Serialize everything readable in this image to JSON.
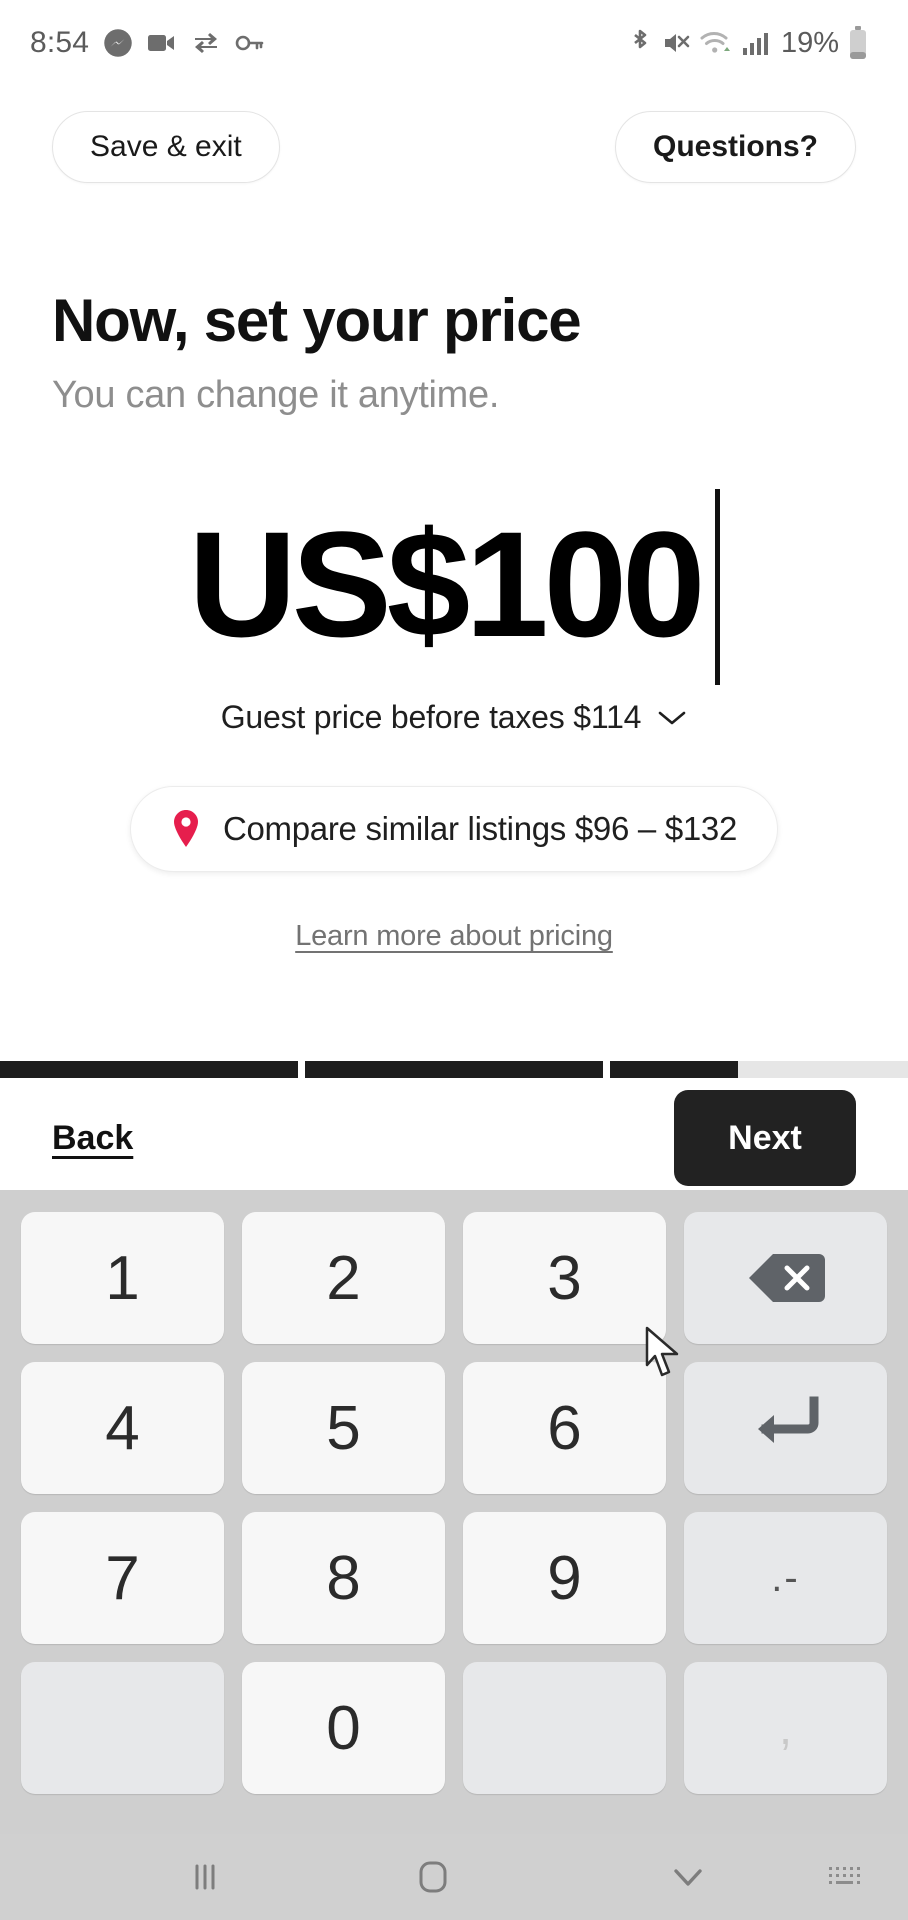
{
  "status_bar": {
    "time": "8:54",
    "battery_percent": "19%",
    "left_icons": [
      "messenger-icon",
      "video-recorder-icon",
      "vpn-icon",
      "key-icon"
    ],
    "right_icons": [
      "bluetooth-icon",
      "mute-icon",
      "wifi-icon",
      "cellular-signal-icon",
      "battery-icon"
    ]
  },
  "topbar": {
    "save_exit_label": "Save & exit",
    "questions_label": "Questions?"
  },
  "main": {
    "headline": "Now, set your price",
    "subhead": "You can change it anytime.",
    "price_value": "US$100",
    "guest_price_label": "Guest price before taxes $114",
    "guest_chevron_icon": "chevron-down-icon",
    "compare_icon": "map-pin-icon",
    "compare_label": "Compare similar listings $96 – $132",
    "learn_more_label": "Learn more about pricing"
  },
  "progress": {
    "segments": [
      100,
      100,
      43
    ]
  },
  "footer": {
    "back_label": "Back",
    "next_label": "Next"
  },
  "keyboard": {
    "rows": [
      [
        {
          "label": "1",
          "name": "key-1",
          "type": "digit"
        },
        {
          "label": "2",
          "name": "key-2",
          "type": "digit"
        },
        {
          "label": "3",
          "name": "key-3",
          "type": "digit"
        },
        {
          "label": "",
          "name": "backspace-icon",
          "type": "backspace"
        }
      ],
      [
        {
          "label": "4",
          "name": "key-4",
          "type": "digit"
        },
        {
          "label": "5",
          "name": "key-5",
          "type": "digit"
        },
        {
          "label": "6",
          "name": "key-6",
          "type": "digit"
        },
        {
          "label": "",
          "name": "enter-icon",
          "type": "enter"
        }
      ],
      [
        {
          "label": "7",
          "name": "key-7",
          "type": "digit"
        },
        {
          "label": "8",
          "name": "key-8",
          "type": "digit"
        },
        {
          "label": "9",
          "name": "key-9",
          "type": "digit"
        },
        {
          "label": ".-",
          "name": "key-dot-dash",
          "type": "dotdash"
        }
      ],
      [
        {
          "label": "",
          "name": "key-blank-left",
          "type": "blank"
        },
        {
          "label": "0",
          "name": "key-0",
          "type": "digit"
        },
        {
          "label": "",
          "name": "key-blank-right",
          "type": "blank"
        },
        {
          "label": ",",
          "name": "key-comma",
          "type": "comma"
        }
      ]
    ]
  },
  "navbar": {
    "items": [
      "recents-icon",
      "home-icon",
      "hide-keyboard-icon",
      "keyboard-switch-icon"
    ]
  },
  "colors": {
    "accent_pin": "#e61e4d",
    "text_primary": "#111111",
    "text_muted": "#8e8e8e",
    "next_button_bg": "#222222",
    "keyboard_bg": "#cfcfcf"
  }
}
